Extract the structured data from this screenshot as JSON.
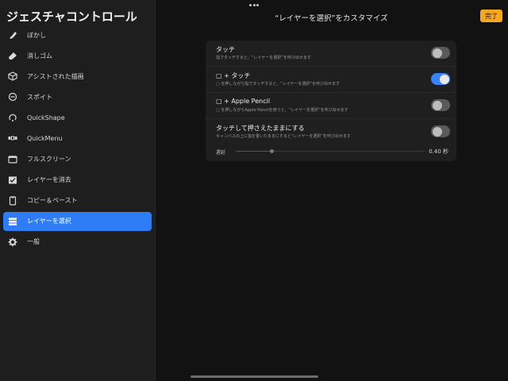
{
  "sidebar": {
    "title": "ジェスチャコントロール",
    "items": [
      {
        "label": "ぼかし",
        "icon": "smudge-brush-icon"
      },
      {
        "label": "消しゴム",
        "icon": "eraser-icon"
      },
      {
        "label": "アシストされた描画",
        "icon": "assisted-drawing-icon"
      },
      {
        "label": "スポイト",
        "icon": "eyedropper-icon"
      },
      {
        "label": "QuickShape",
        "icon": "quickshape-icon"
      },
      {
        "label": "QuickMenu",
        "icon": "quickmenu-icon"
      },
      {
        "label": "フルスクリーン",
        "icon": "fullscreen-icon"
      },
      {
        "label": "レイヤーを消去",
        "icon": "clear-layer-icon"
      },
      {
        "label": "コピー＆ペースト",
        "icon": "copy-paste-icon"
      },
      {
        "label": "レイヤーを選択",
        "icon": "select-layer-icon",
        "active": true
      },
      {
        "label": "一般",
        "icon": "gear-icon"
      }
    ]
  },
  "header": {
    "title": "“レイヤーを選択”をカスタマイズ",
    "done_label": "完了"
  },
  "settings": {
    "rows": [
      {
        "title": "タッチ",
        "desc": "指でタッチすると、“レイヤーを選択”を呼び出せます",
        "on": false
      },
      {
        "title": "▢ + タッチ",
        "desc": "▢ を押しながら指でタッチすると、“レイヤーを選択”を呼び出せます",
        "on": true
      },
      {
        "title": "▢ + Apple Pencil",
        "desc": "▢ を押しながらApple Pencilを使うと、“レイヤーを選択”を呼び出せます",
        "on": false
      },
      {
        "title": "タッチして押さえたままにする",
        "desc": "キャンバスの上に指を置いたままにすると“レイヤーを選択”を呼び出せます",
        "on": false
      }
    ],
    "delay": {
      "label": "遅延",
      "value": "0.40 秒",
      "fraction": 0.19
    }
  },
  "colors": {
    "accent": "#2f7df6",
    "done": "#f5a623",
    "toggle_on": "#3a82f7"
  }
}
